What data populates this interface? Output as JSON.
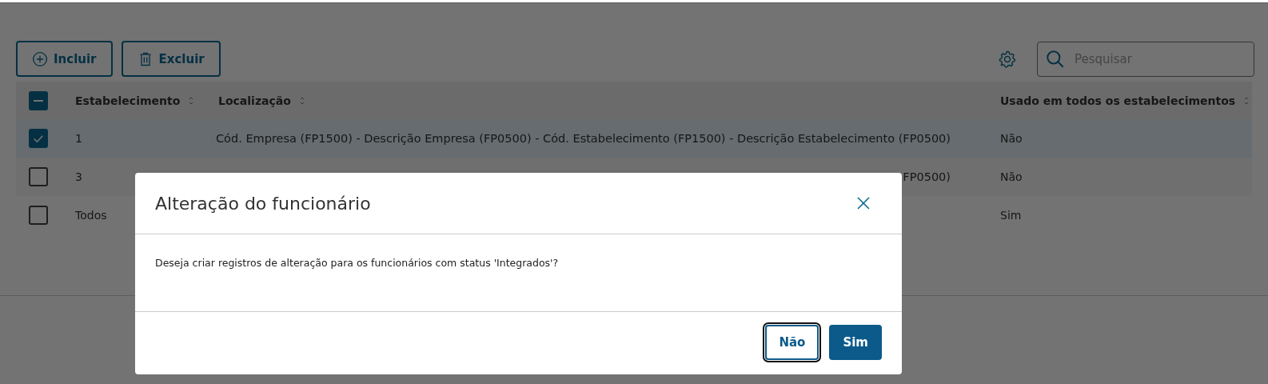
{
  "toolbar": {
    "buttons": [
      {
        "label": "Incluir"
      },
      {
        "label": "Excluir"
      }
    ],
    "search": {
      "placeholder": "Pesquisar"
    }
  },
  "table": {
    "select_all": {
      "indeterminate": true
    },
    "columns": [
      {
        "label": "Estabelecimento"
      },
      {
        "label": "Localização"
      },
      {
        "label": "Usado em todos os estabelecimentos"
      }
    ],
    "rows": [
      {
        "selected": true,
        "cells": [
          "1",
          "Cód. Empresa (FP1500) - Descrição Empresa (FP0500) - Cód. Estabelecimento (FP1500) - Descrição Estabelecimento (FP0500)",
          "Não"
        ]
      },
      {
        "selected": false,
        "cells": [
          "3",
          "FP0500)",
          "Não"
        ]
      },
      {
        "selected": false,
        "cells": [
          "Todos",
          "",
          "Sim"
        ]
      }
    ]
  },
  "dialog": {
    "title": "Alteração do funcionário",
    "message": "Deseja criar registros de alteração para os funcionários com status 'Integrados'?",
    "buttons": [
      {
        "label": "Não",
        "kind": "secondary",
        "focused": true
      },
      {
        "label": "Sim",
        "kind": "primary",
        "focused": false
      }
    ]
  }
}
